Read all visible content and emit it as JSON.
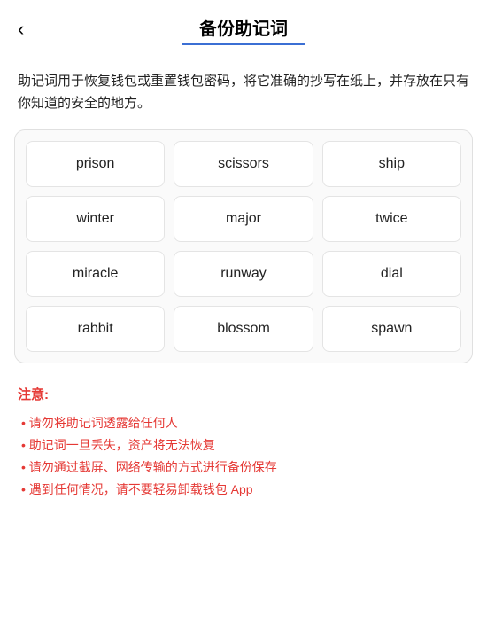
{
  "header": {
    "back_label": "‹",
    "title": "备份助记词",
    "underline_color": "#3b6fd4"
  },
  "description": "助记词用于恢复钱包或重置钱包密码，将它准确的抄写在纸上，并存放在只有你知道的安全的地方。",
  "mnemonic": {
    "words": [
      "prison",
      "scissors",
      "ship",
      "winter",
      "major",
      "twice",
      "miracle",
      "runway",
      "dial",
      "rabbit",
      "blossom",
      "spawn"
    ]
  },
  "notice": {
    "title": "注意:",
    "items": [
      "请勿将助记词透露给任何人",
      "助记词一旦丢失，资产将无法恢复",
      "请勿通过截屏、网络传输的方式进行备份保存",
      "遇到任何情况，请不要轻易卸载钱包 App"
    ]
  }
}
